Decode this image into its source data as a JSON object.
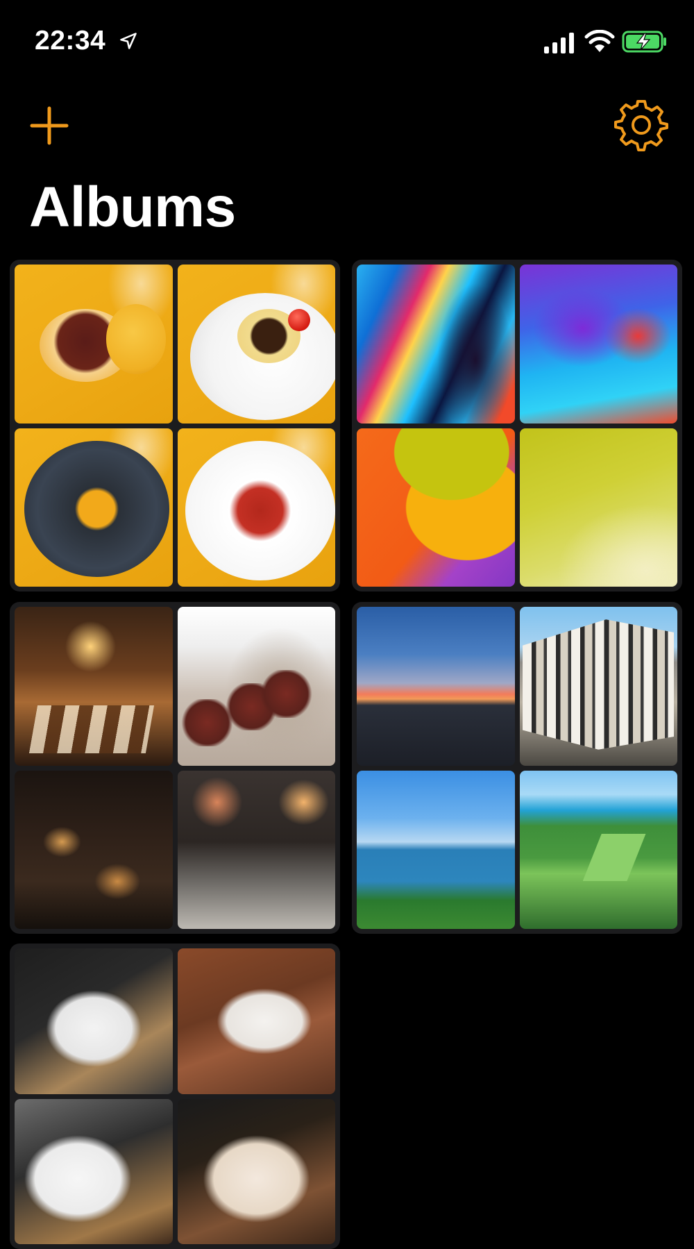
{
  "status_bar": {
    "time": "22:34",
    "icons": [
      "location-arrow-icon",
      "cellular-signal-icon",
      "wifi-icon",
      "battery-charging-icon"
    ]
  },
  "nav": {
    "add_icon": "plus-icon",
    "settings_icon": "gear-icon",
    "accent_color": "#f09a1c"
  },
  "page": {
    "title": "Albums"
  },
  "albums": [
    {
      "theme": "food",
      "thumbnails": 4
    },
    {
      "theme": "abstract-colors",
      "thumbnails": 4
    },
    {
      "theme": "interiors",
      "thumbnails": 4
    },
    {
      "theme": "landscapes",
      "thumbnails": 4
    },
    {
      "theme": "cats",
      "thumbnails": 4
    }
  ],
  "colors": {
    "background": "#000000",
    "album_card": "#1c1c1e",
    "text": "#ffffff",
    "accent": "#f09a1c",
    "battery_fill": "#4cd964"
  }
}
